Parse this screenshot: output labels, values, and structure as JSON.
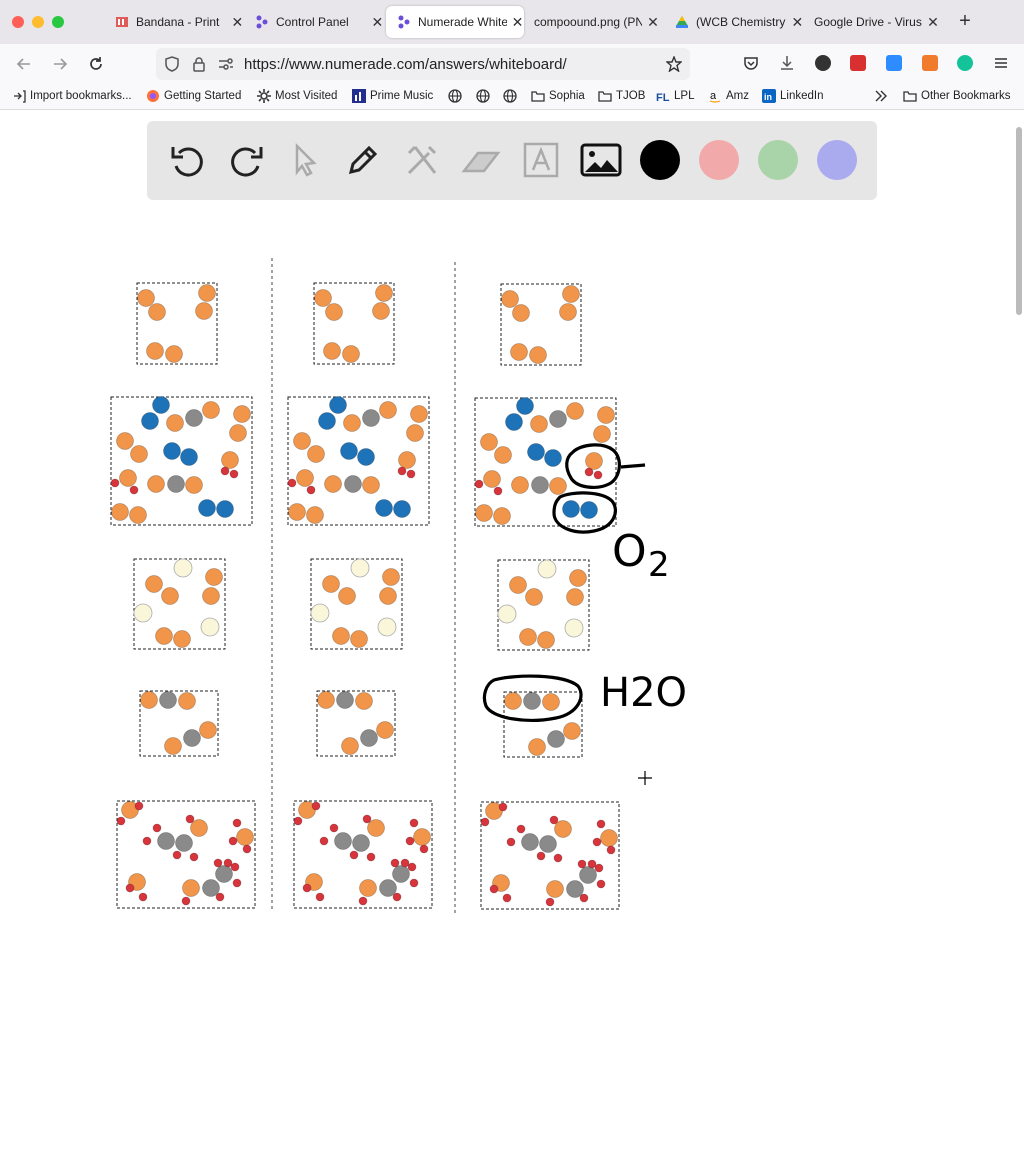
{
  "tabs": [
    {
      "label": "Bandana - Print",
      "icon": "bandana-icon",
      "active": false
    },
    {
      "label": "Control Panel",
      "icon": "numerade-icon",
      "active": false
    },
    {
      "label": "Numerade White",
      "icon": "numerade-icon",
      "active": true
    },
    {
      "label": "compoound.png (PN",
      "icon": "none",
      "active": false
    },
    {
      "label": "(WCB Chemistry",
      "icon": "google-drive-icon",
      "active": false
    },
    {
      "label": "Google Drive - Virus",
      "icon": "none",
      "active": false
    }
  ],
  "url": "https://www.numerade.com/answers/whiteboard/",
  "bookmarks": [
    {
      "label": "Import bookmarks...",
      "icon": "import-icon"
    },
    {
      "label": "Getting Started",
      "icon": "firefox-icon"
    },
    {
      "label": "Most Visited",
      "icon": "gear-icon"
    },
    {
      "label": "Prime Music",
      "icon": "prime-music-icon"
    },
    {
      "label": "",
      "icon": "globe-icon"
    },
    {
      "label": "",
      "icon": "globe-icon"
    },
    {
      "label": "",
      "icon": "globe-icon"
    },
    {
      "label": "Sophia",
      "icon": "folder-icon"
    },
    {
      "label": "TJOB",
      "icon": "folder-icon"
    },
    {
      "label": "LPL",
      "icon": "lpl-icon"
    },
    {
      "label": "Amz",
      "icon": "amazon-icon"
    },
    {
      "label": "LinkedIn",
      "icon": "linkedin-icon"
    }
  ],
  "other_bookmarks": "Other Bookmarks",
  "whiteboard_tools": [
    "undo-icon",
    "redo-icon",
    "pointer-icon",
    "pen-icon",
    "tools-icon",
    "eraser-icon",
    "text-icon",
    "image-icon"
  ],
  "colors": {
    "black": "#000000",
    "pink": "#f2a9a9",
    "green": "#a9d3a9",
    "purple": "#aaaaee",
    "atom_orange": "#f0954a",
    "atom_blue": "#1e73b8",
    "atom_gray": "#8a8a8a",
    "atom_red": "#d8343c",
    "atom_cream": "#faf6da"
  },
  "annotations": {
    "o2_label": "O",
    "o2_sub": "2",
    "h2o_label": "H2O"
  }
}
